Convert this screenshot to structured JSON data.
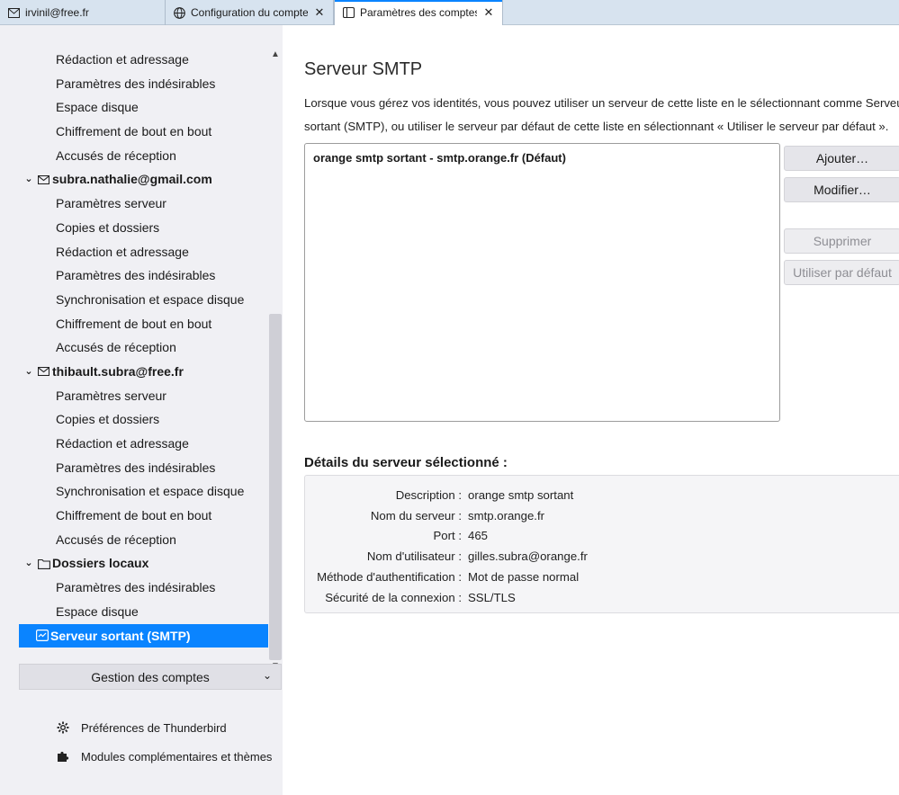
{
  "tabs": [
    {
      "label": "irvinil@free.fr",
      "icon": "mail-icon"
    },
    {
      "label": "Configuration du compte",
      "icon": "globe-icon"
    },
    {
      "label": "Paramètres des comptes Co",
      "icon": "settings-page-icon"
    }
  ],
  "sidebar": {
    "tree": {
      "r0": "Rédaction et adressage",
      "r1": "Paramètres des indésirables",
      "r2": "Espace disque",
      "r3": "Chiffrement de bout en bout",
      "r4": "Accusés de réception",
      "acc1": "subra.nathalie@gmail.com",
      "r6": "Paramètres serveur",
      "r7": "Copies et dossiers",
      "r8": "Rédaction et adressage",
      "r9": "Paramètres des indésirables",
      "r10": "Synchronisation et espace disque",
      "r11": "Chiffrement de bout en bout",
      "r12": "Accusés de réception",
      "acc2": "thibault.subra@free.fr",
      "r14": "Paramètres serveur",
      "r15": "Copies et dossiers",
      "r16": "Rédaction et adressage",
      "r17": "Paramètres des indésirables",
      "r18": "Synchronisation et espace disque",
      "r19": "Chiffrement de bout en bout",
      "r20": "Accusés de réception",
      "acc3": "Dossiers locaux",
      "r22": "Paramètres des indésirables",
      "r23": "Espace disque",
      "selected": "Serveur sortant (SMTP)"
    },
    "manage_accounts": "Gestion des comptes",
    "preferences": "Préférences de Thunderbird",
    "addons": "Modules complémentaires et thèmes"
  },
  "main": {
    "title": "Serveur SMTP",
    "intro": "Lorsque vous gérez vos identités, vous pouvez utiliser un serveur de cette liste en le sélectionnant comme Serveur sortant (SMTP), ou utiliser le serveur par défaut de cette liste en sélectionnant « Utiliser le serveur par défaut ».",
    "servers": [
      "orange smtp sortant - smtp.orange.fr (Défaut)"
    ],
    "buttons": {
      "add": "Ajouter…",
      "edit": "Modifier…",
      "delete": "Supprimer",
      "set_default": "Utiliser par défaut"
    },
    "details_title": "Détails du serveur sélectionné :",
    "details": {
      "description_label": "Description :",
      "description": "orange smtp sortant",
      "server_label": "Nom du serveur :",
      "server": "smtp.orange.fr",
      "port_label": "Port :",
      "port": "465",
      "user_label": "Nom d'utilisateur :",
      "user": "gilles.subra@orange.fr",
      "auth_label": "Méthode d'authentification :",
      "auth": "Mot de passe normal",
      "security_label": "Sécurité de la connexion :",
      "security": "SSL/TLS"
    }
  },
  "colors": {
    "accent": "#0a84ff",
    "sidebar_bg": "#f0f0f4",
    "tabbar_bg": "#d7e3ef"
  }
}
